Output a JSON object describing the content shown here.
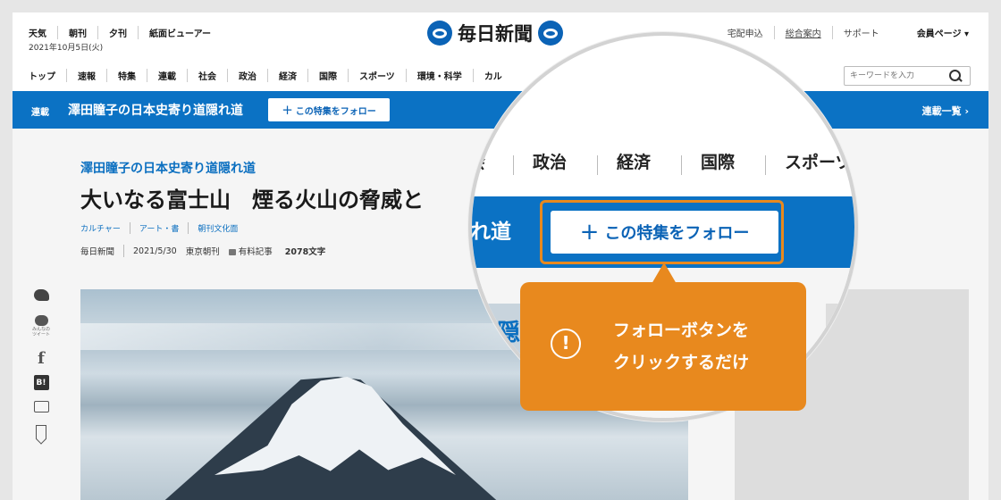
{
  "header": {
    "left_links": [
      "天気",
      "朝刊",
      "夕刊",
      "紙面ビューアー"
    ],
    "logo_text": "毎日新聞",
    "right_links": [
      "宅配申込",
      "総合案内",
      "サポート"
    ],
    "member_label": "会員ページ ▾",
    "date": "2021年10月5日(火)"
  },
  "nav": {
    "categories": [
      "トップ",
      "速報",
      "特集",
      "連載",
      "社会",
      "政治",
      "経済",
      "国際",
      "スポーツ",
      "環境・科学",
      "カル"
    ],
    "search_placeholder": "キーワードを入力"
  },
  "series_bar": {
    "tag": "連載",
    "title": "澤田瞳子の日本史寄り道隠れ道",
    "follow_label": "この特集をフォロー",
    "plus": "+",
    "list_label": "連載一覧 ›"
  },
  "article": {
    "series_title": "澤田瞳子の日本史寄り道隠れ道",
    "headline": "大いなる富士山　煙る火山の脅威と",
    "tags": [
      "カルチャー",
      "アート・書",
      "朝刊文化面"
    ],
    "source": "毎日新聞",
    "date": "2021/5/30",
    "edition": "東京朝刊",
    "paid_label": "有料記事",
    "char_count": "2078文字"
  },
  "share": {
    "tweet_label": "みんなの\nツイート",
    "facebook": "f",
    "hatena": "B!"
  },
  "magnifier": {
    "nav_items": [
      "政治",
      "経済",
      "国際",
      "スポーツ"
    ],
    "nav_partial": "会",
    "title_partial": "れ道",
    "follow_label": "この特集をフォロー",
    "plus": "+",
    "series_partial": "隠"
  },
  "callout": {
    "icon": "!",
    "line1": "フォローボタンを",
    "line2": "クリックするだけ"
  },
  "colors": {
    "brand_blue": "#0b72c4",
    "accent_orange": "#e8891e"
  }
}
